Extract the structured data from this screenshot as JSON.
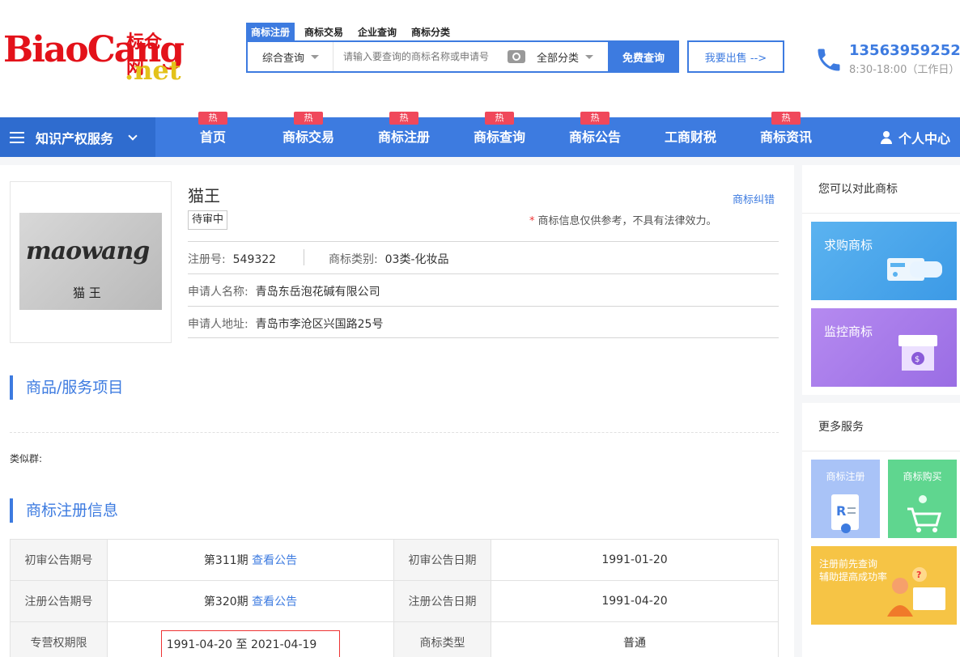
{
  "logo": {
    "en": "BiaoCang",
    "cn": "标仓网",
    "dot": ".net"
  },
  "search": {
    "tabs": [
      "商标注册",
      "商标交易",
      "企业查询",
      "商标分类"
    ],
    "type": "综合查询",
    "placeholder": "请输入要查询的商标名称或申请号",
    "category": "全部分类",
    "button": "免费查询"
  },
  "sell_button": "我要出售 -->",
  "contact": {
    "phone": "13563959252",
    "hours": "8:30-18:00（工作日）"
  },
  "nav": {
    "services": "知识产权服务",
    "items": [
      {
        "label": "首页",
        "hot": "热"
      },
      {
        "label": "商标交易",
        "hot": "热"
      },
      {
        "label": "商标注册",
        "hot": "热"
      },
      {
        "label": "商标查询",
        "hot": "热"
      },
      {
        "label": "商标公告",
        "hot": "热"
      },
      {
        "label": "工商财税",
        "hot": ""
      },
      {
        "label": "商标资讯",
        "hot": "热"
      }
    ],
    "user": "个人中心"
  },
  "trademark": {
    "image_en": "maowang",
    "image_cn": "猫 王",
    "name": "猫王",
    "status": "待审中",
    "correct_link": "商标纠错",
    "note_star": "*",
    "note": "商标信息仅供参考，不具有法律效力。",
    "reg_no_label": "注册号:",
    "reg_no": "549322",
    "class_label": "商标类别:",
    "class": "03类-化妆品",
    "applicant_label": "申请人名称:",
    "applicant": "青岛东岳泡花碱有限公司",
    "address_label": "申请人地址:",
    "address": "青岛市李沧区兴国路25号"
  },
  "goods_section": {
    "title": "商品/服务项目",
    "similar_label": "类似群:"
  },
  "reg_section": {
    "title": "商标注册信息",
    "rows": [
      {
        "h1": "初审公告期号",
        "v1": "第311期",
        "link": "查看公告",
        "h2": "初审公告日期",
        "v2": "1991-01-20"
      },
      {
        "h1": "注册公告期号",
        "v1": "第320期",
        "link": "查看公告",
        "h2": "注册公告日期",
        "v2": "1991-04-20"
      },
      {
        "h1": "专营权期限",
        "v1": "1991-04-20 至 2021-04-19",
        "link": "",
        "h2": "商标类型",
        "v2": "普通"
      }
    ]
  },
  "sidebar": {
    "compare_title": "您可以对此商标",
    "buy_banner": "求购商标",
    "monitor_banner": "监控商标",
    "more_title": "更多服务",
    "svc_register": "商标注册",
    "svc_buy": "商标购买",
    "svc_check_line1": "注册前先查询",
    "svc_check_line2": "辅助提高成功率"
  },
  "colors": {
    "brand": "#3d7be0",
    "hot": "#f0485b",
    "logo_red": "#e3121a"
  }
}
